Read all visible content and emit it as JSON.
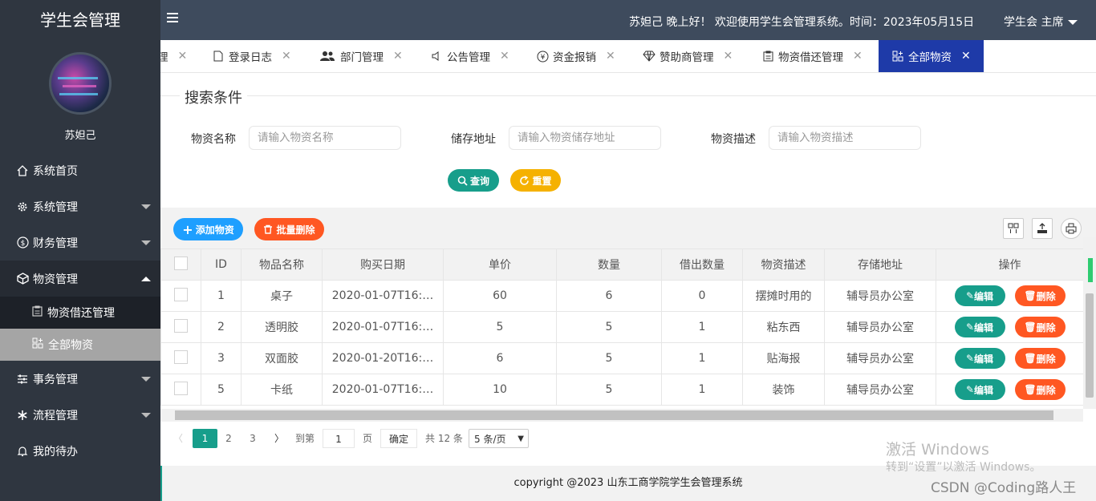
{
  "sidebar": {
    "logo": "学生会管理",
    "username": "苏妲己",
    "menu": [
      {
        "label": "系统首页",
        "icon": "home-icon"
      },
      {
        "label": "系统管理",
        "icon": "gear-icon"
      },
      {
        "label": "财务管理",
        "icon": "dollar-icon"
      },
      {
        "label": "物资管理",
        "icon": "box-icon"
      },
      {
        "label": "物资借还管理",
        "icon": "clipboard-icon"
      },
      {
        "label": "全部物资",
        "icon": "grid-icon"
      },
      {
        "label": "事务管理",
        "icon": "sliders-icon"
      },
      {
        "label": "流程管理",
        "icon": "snowflake-icon"
      },
      {
        "label": "我的待办",
        "icon": "bell-icon"
      }
    ]
  },
  "header": {
    "greeting": "苏妲己 晚上好！ 欢迎使用学生会管理系统。时间：2023年05月15日",
    "role": "学生会 主席"
  },
  "tabs": [
    {
      "label": "理"
    },
    {
      "label": "登录日志"
    },
    {
      "label": "部门管理"
    },
    {
      "label": "公告管理"
    },
    {
      "label": "资金报销"
    },
    {
      "label": "赞助商管理"
    },
    {
      "label": "物资借还管理"
    },
    {
      "label": "全部物资"
    }
  ],
  "search": {
    "title": "搜索条件",
    "fields": [
      {
        "label": "物资名称",
        "placeholder": "请输入物资名称"
      },
      {
        "label": "储存地址",
        "placeholder": "请输入物资储存地址"
      },
      {
        "label": "物资描述",
        "placeholder": "请输入物资描述"
      }
    ],
    "query_label": "查询",
    "reset_label": "重置"
  },
  "toolbar": {
    "add_label": "添加物资",
    "batch_delete_label": "批量删除"
  },
  "table": {
    "headers": [
      "ID",
      "物品名称",
      "购买日期",
      "单价",
      "数量",
      "借出数量",
      "物资描述",
      "存储地址",
      "操作"
    ],
    "rows": [
      [
        "1",
        "桌子",
        "2020-01-07T16:…",
        "60",
        "6",
        "0",
        "摆摊时用的",
        "辅导员办公室"
      ],
      [
        "2",
        "透明胶",
        "2020-01-07T16:…",
        "5",
        "5",
        "1",
        "粘东西",
        "辅导员办公室"
      ],
      [
        "3",
        "双面胶",
        "2020-01-20T16:…",
        "6",
        "5",
        "1",
        "贴海报",
        "辅导员办公室"
      ],
      [
        "5",
        "卡纸",
        "2020-01-07T16:…",
        "10",
        "5",
        "1",
        "装饰",
        "辅导员办公室"
      ]
    ],
    "edit_label": "编辑",
    "delete_label": "删除"
  },
  "pager": {
    "pages": [
      "1",
      "2",
      "3"
    ],
    "goto_label": "到第",
    "goto_value": "1",
    "page_unit": "页",
    "confirm_label": "确定",
    "total": "共 12 条",
    "page_size": "5 条/页"
  },
  "footer": "copyright @2023 山东工商学院学生会管理系统",
  "watermark": {
    "line1": "激活 Windows",
    "line2": "转到“设置”以激活 Windows。",
    "csdn": "CSDN @Coding路人王"
  },
  "colors": {
    "teal": "#179e8b",
    "orange": "#ff5722",
    "yellow": "#f5b100",
    "blue": "#1e9fff",
    "active_tab": "#1e3aa8"
  }
}
